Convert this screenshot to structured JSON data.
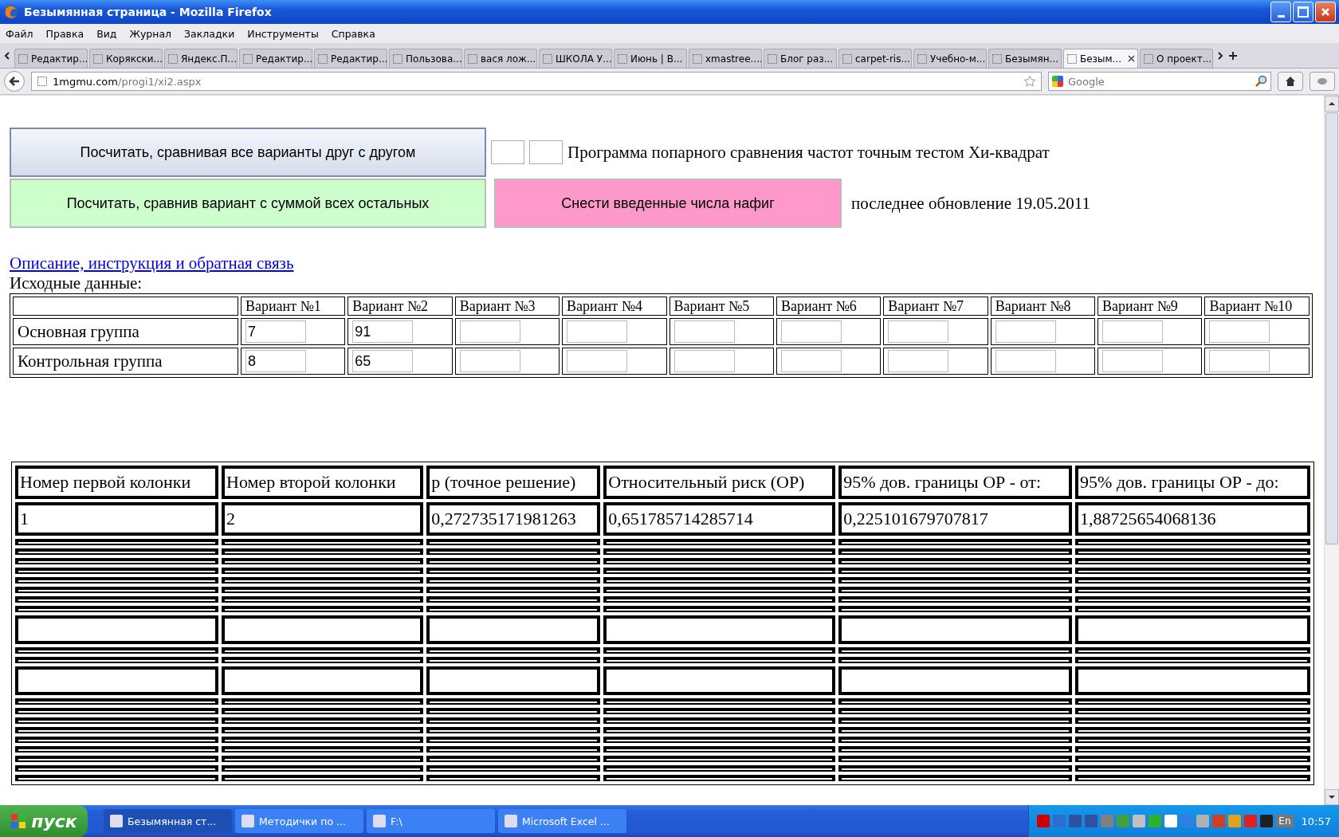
{
  "window": {
    "title": "Безымянная страница - Mozilla Firefox"
  },
  "menu": [
    "Файл",
    "Правка",
    "Вид",
    "Журнал",
    "Закладки",
    "Инструменты",
    "Справка"
  ],
  "tabs": [
    {
      "label": "Редактир...",
      "selected": false
    },
    {
      "label": "Корякски...",
      "selected": false
    },
    {
      "label": "Яндекс.П...",
      "selected": false
    },
    {
      "label": "Редактир...",
      "selected": false
    },
    {
      "label": "Редактир...",
      "selected": false
    },
    {
      "label": "Пользова...",
      "selected": false
    },
    {
      "label": "вася лож...",
      "selected": false
    },
    {
      "label": "ШКОЛА У...",
      "selected": false
    },
    {
      "label": "Июнь | В...",
      "selected": false
    },
    {
      "label": "xmastree....",
      "selected": false
    },
    {
      "label": "Блог раз...",
      "selected": false
    },
    {
      "label": "carpet-ris...",
      "selected": false
    },
    {
      "label": "Учебно-м...",
      "selected": false
    },
    {
      "label": "Безымян...",
      "selected": false
    },
    {
      "label": "Безым...",
      "selected": true
    },
    {
      "label": "О проект...",
      "selected": false
    }
  ],
  "address": {
    "host": "1mgmu.com",
    "path": "/progi1/xi2.aspx"
  },
  "search": {
    "placeholder": "Google"
  },
  "page": {
    "buttons": [
      {
        "label": "Посчитать, сравнивая все варианты друг с другом",
        "kind": "blue"
      },
      {
        "label": "Посчитать, сравнив вариант с суммой всех остальных",
        "kind": "green"
      },
      {
        "label": "Снести введенные числа нафиг",
        "kind": "pink"
      }
    ],
    "title": "Программа попарного сравнения частот точным тестом Хи-квадрат",
    "updated": "последнее обновление 19.05.2011",
    "link": "Описание, инструкция и обратная связь",
    "input_label": "Исходные данные:",
    "input_table": {
      "columns": [
        "Вариант №1",
        "Вариант №2",
        "Вариант №3",
        "Вариант №4",
        "Вариант №5",
        "Вариант №6",
        "Вариант №7",
        "Вариант №8",
        "Вариант №9",
        "Вариант №10"
      ],
      "rows": [
        {
          "label": "Основная группа",
          "values": [
            "7",
            "91"
          ]
        },
        {
          "label": "Контрольная группа",
          "values": [
            "8",
            "65"
          ]
        }
      ]
    },
    "results": {
      "columns": [
        "Номер первой колонки",
        "Номер второй колонки",
        "р (точное решение)",
        "Относительный риск (ОР)",
        "95% дов. границы ОР - от:",
        "95% дов. границы ОР - до:"
      ],
      "rows": [
        {
          "kind": "data",
          "cells": [
            "1",
            "2",
            "0,272735171981263",
            "0,651785714285714",
            "0,225101679707817",
            "1,88725654068136"
          ]
        },
        {
          "kind": "collapsed"
        },
        {
          "kind": "collapsed"
        },
        {
          "kind": "collapsed"
        },
        {
          "kind": "collapsed"
        },
        {
          "kind": "collapsed"
        },
        {
          "kind": "collapsed"
        },
        {
          "kind": "collapsed"
        },
        {
          "kind": "collapsed"
        },
        {
          "kind": "blank"
        },
        {
          "kind": "collapsed"
        },
        {
          "kind": "collapsed"
        },
        {
          "kind": "blank"
        },
        {
          "kind": "collapsed"
        },
        {
          "kind": "collapsed"
        },
        {
          "kind": "collapsed"
        },
        {
          "kind": "collapsed"
        },
        {
          "kind": "collapsed"
        },
        {
          "kind": "collapsed"
        },
        {
          "kind": "collapsed"
        },
        {
          "kind": "collapsed"
        },
        {
          "kind": "collapsed"
        }
      ]
    }
  },
  "taskbar": {
    "start": "пуск",
    "items": [
      {
        "label": "Безымянная ст...",
        "selected": true
      },
      {
        "label": "Методички по ...",
        "selected": false
      },
      {
        "label": "F:\\",
        "selected": false
      },
      {
        "label": "Microsoft Excel ...",
        "selected": false
      }
    ],
    "language": "En",
    "clock": "10:57"
  }
}
